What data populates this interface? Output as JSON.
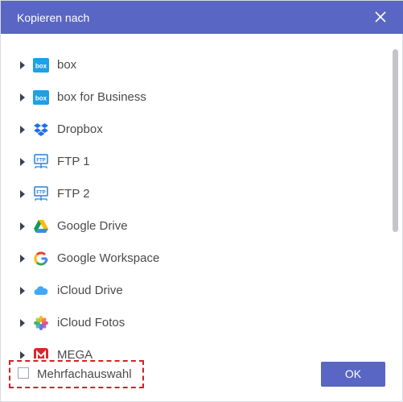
{
  "dialog": {
    "title": "Kopieren nach",
    "close_label": "×",
    "items": [
      {
        "label": "box",
        "icon": "box-icon"
      },
      {
        "label": "box for Business",
        "icon": "box-icon"
      },
      {
        "label": "Dropbox",
        "icon": "dropbox-icon"
      },
      {
        "label": "FTP 1",
        "icon": "ftp-icon"
      },
      {
        "label": "FTP 2",
        "icon": "ftp-icon"
      },
      {
        "label": "Google Drive",
        "icon": "google-drive-icon"
      },
      {
        "label": "Google Workspace",
        "icon": "google-icon"
      },
      {
        "label": "iCloud Drive",
        "icon": "icloud-icon"
      },
      {
        "label": "iCloud Fotos",
        "icon": "icloud-photos-icon"
      },
      {
        "label": "MEGA",
        "icon": "mega-icon"
      }
    ],
    "multi_select_label": "Mehrfachauswahl",
    "multi_select_checked": false,
    "ok_label": "OK"
  },
  "colors": {
    "titlebar": "#5a66c4",
    "button": "#5a66c4",
    "highlight_border": "#d61f26"
  }
}
